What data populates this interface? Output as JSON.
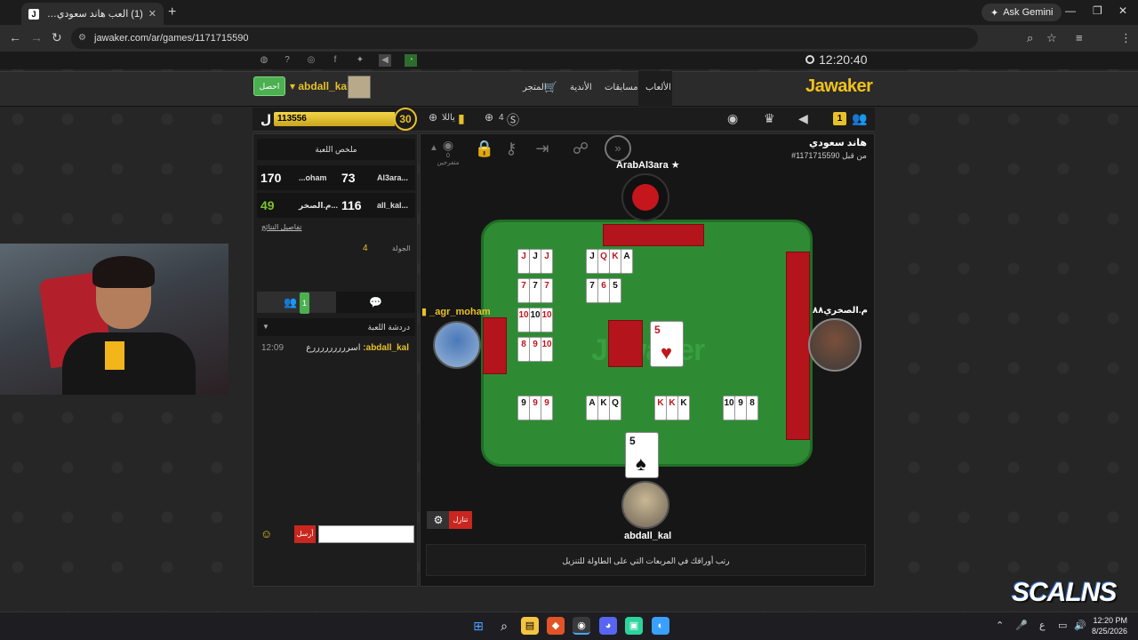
{
  "browser": {
    "tab_title": "(1) العب هاند سعودي مع أص...",
    "tab_favicon": "J",
    "new_tab": "+",
    "ask_gemini": "Ask Gemini",
    "url": "jawaker.com/ar/games/1171715590",
    "icons": [
      "back-icon",
      "forward-icon",
      "reload-icon",
      "site-info-icon",
      "zoom-icon",
      "star-icon",
      "profile-icon",
      "menu-icon"
    ]
  },
  "site": {
    "clock": "12:20:40",
    "logo": "Jawaker",
    "nav": {
      "games": "الألعاب",
      "competitions": "مسابقات",
      "clubs": "الأندية",
      "store": "المتجر"
    },
    "earn_button": "احصل",
    "username": "abdall_kal",
    "xp_value": "113556",
    "xp_fill_fraction": 0.97,
    "level": "30",
    "level_letter": "ل",
    "tokens_label": "ياللا",
    "token_count": "4",
    "notif_count": "1"
  },
  "summary": {
    "title": "ملخص اللعبة",
    "rows": [
      {
        "left_name": "Al3ara...",
        "left_score": "73",
        "right_name": "...oham",
        "right_score": "170",
        "right_green": false
      },
      {
        "left_name": "all_kal...",
        "left_score": "116",
        "right_name": "م.الصخر...",
        "right_score": "49",
        "right_green": true
      }
    ],
    "details_link": "تفاصيل النتائج",
    "round_label": "الجولة",
    "round_value": "4"
  },
  "chat": {
    "tab_count": "1",
    "header": "دردشة اللعبة",
    "messages": [
      {
        "time": "12:09",
        "user": "abdall_kal",
        "text": "اسرررررررررع"
      }
    ],
    "send_label": "أرسل"
  },
  "game": {
    "title": "هاند سعودي",
    "id": "#1171715590 من قبل",
    "spectators": "0 متفرجين",
    "players": {
      "top": "ArabAl3ara",
      "left": "_agr_moham",
      "right": "م.الصخري٨٨",
      "bottom": "abdall_kal"
    },
    "watermark": "Jawaker",
    "center_card": {
      "rank": "5",
      "suit": "♥"
    },
    "hand_card": {
      "rank": "5",
      "suit": "♠"
    },
    "melds": [
      {
        "ranks": [
          "J",
          "J",
          "J"
        ],
        "colors": [
          "red",
          "blk",
          "red"
        ]
      },
      {
        "ranks": [
          "J",
          "Q",
          "K",
          "A"
        ],
        "colors": [
          "blk",
          "red",
          "red",
          "blk"
        ]
      },
      {
        "ranks": [
          "7",
          "7",
          "7"
        ],
        "colors": [
          "red",
          "blk",
          "red"
        ]
      },
      {
        "ranks": [
          "7",
          "6",
          "5"
        ],
        "colors": [
          "blk",
          "red",
          "blk"
        ]
      },
      {
        "ranks": [
          "10",
          "10",
          "10"
        ],
        "colors": [
          "red",
          "blk",
          "red"
        ]
      },
      {
        "ranks": [
          "8",
          "9",
          "10"
        ],
        "colors": [
          "red",
          "red",
          "red"
        ]
      },
      {
        "ranks": [
          "9",
          "9",
          "9"
        ],
        "colors": [
          "blk",
          "red",
          "red"
        ]
      },
      {
        "ranks": [
          "A",
          "K",
          "Q"
        ],
        "colors": [
          "blk",
          "blk",
          "blk"
        ]
      },
      {
        "ranks": [
          "K",
          "K",
          "K"
        ],
        "colors": [
          "red",
          "red",
          "blk"
        ]
      },
      {
        "ranks": [
          "10",
          "9",
          "8"
        ],
        "colors": [
          "blk",
          "blk",
          "blk"
        ]
      }
    ],
    "leave_button": "تنازل",
    "hint": "رتب أوراقك في المربعات التي على الطاولة للتنزيل"
  },
  "taskbar": {
    "time": "12:20 PM",
    "date": "8/25/2026",
    "lang": "ع"
  },
  "overlay": "SCALNS"
}
